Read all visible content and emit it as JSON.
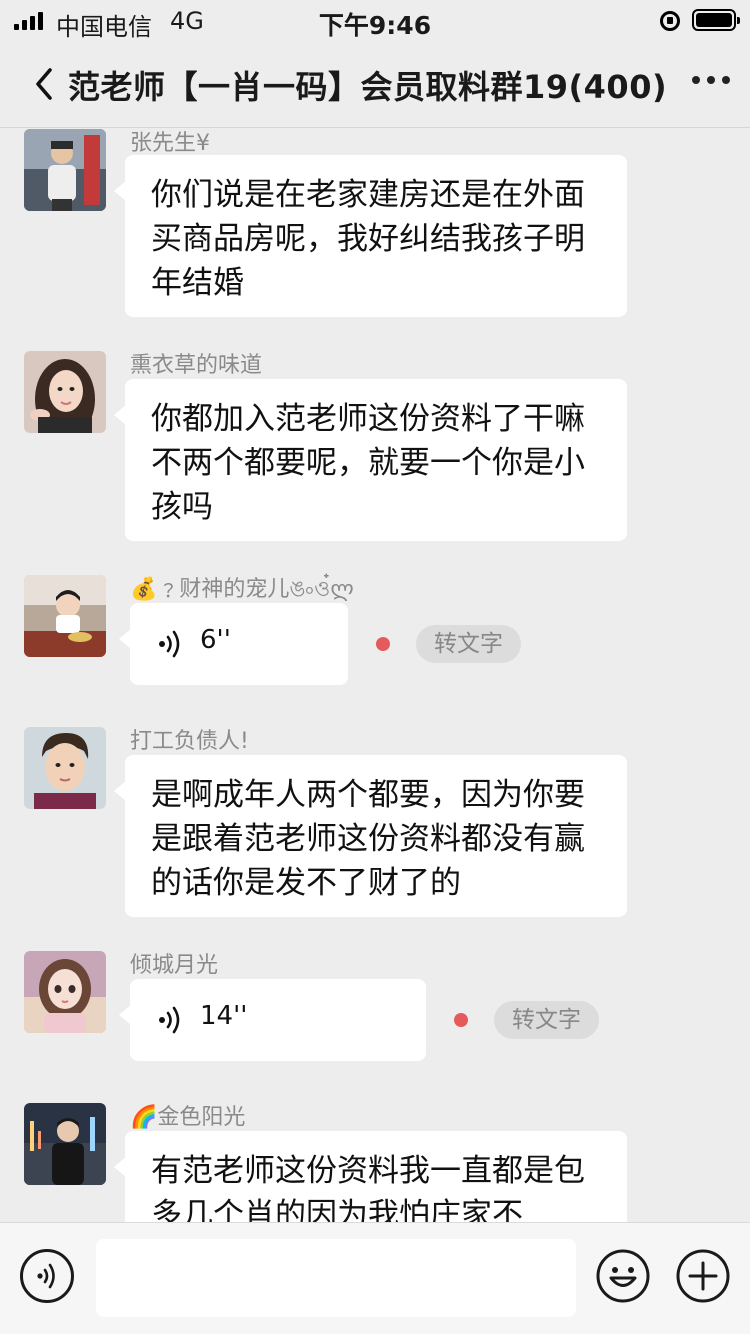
{
  "status_bar": {
    "carrier": "中国电信",
    "network": "4G",
    "time": "下午9:46",
    "battery_level": 1.0
  },
  "header": {
    "title": "范老师【一肖一码】会员取料群19(400)"
  },
  "messages": [
    {
      "type": "text",
      "sender": "张先生¥",
      "text": "你们说是在老家建房还是在外面买商品房呢，我好纠结我孩子明年结婚"
    },
    {
      "type": "text",
      "sender": "熏衣草的味道",
      "text": "你都加入范老师这份资料了干嘛不两个都要呢，就要一个你是小孩吗"
    },
    {
      "type": "voice",
      "sender": "💰﹖财神的宠儿ঙ৹ও๋ლ",
      "duration": "6''",
      "convert_label": "转文字"
    },
    {
      "type": "text",
      "sender": "打工负债人!",
      "text": "是啊成年人两个都要，因为你要是跟着范老师这份资料都没有赢的话你是发不了财了的"
    },
    {
      "type": "voice",
      "sender": "倾城月光",
      "duration": "14''",
      "convert_label": "转文字"
    },
    {
      "type": "text",
      "sender": "🌈金色阳光",
      "text": "有范老师这份资料我一直都是包多几个肖的因为我怕庄家不"
    }
  ],
  "input": {
    "value": "",
    "placeholder": ""
  },
  "icons": {
    "back": "chevron-left-icon",
    "more": "more-dots-icon",
    "voice_input": "voice-input-icon",
    "emoji": "emoji-icon",
    "plus": "plus-icon"
  },
  "colors": {
    "background": "#ededed",
    "bubble": "#ffffff",
    "unread_dot": "#e55a5a",
    "sender_text": "#8a8a8a"
  }
}
